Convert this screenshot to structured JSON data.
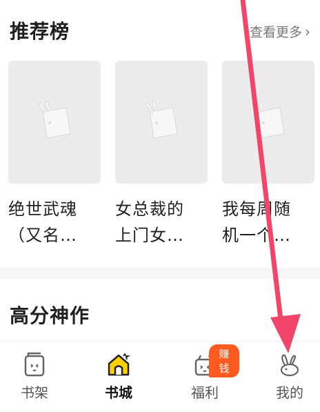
{
  "recommend": {
    "title": "推荐榜",
    "see_more": "查看更多",
    "books": [
      {
        "line1": "绝世武魂",
        "line2": "（又名…"
      },
      {
        "line1": "女总裁的",
        "line2": "上门女…"
      },
      {
        "line1": "我每周随",
        "line2": "机一个…"
      }
    ]
  },
  "section2": {
    "title": "高分神作"
  },
  "tabbar": {
    "tabs": [
      {
        "label": "书架"
      },
      {
        "label": "书城"
      },
      {
        "label": "福利"
      },
      {
        "label": "我的"
      }
    ],
    "welfare_badge": "赚钱",
    "active_tab": "书城"
  },
  "icons": {
    "cover_placeholder": "rabbit-book-icon",
    "shelf": "book-shelf-icon",
    "store": "house-icon",
    "welfare": "gift-box-icon",
    "mine": "rabbit-icon",
    "see_more": "chevron-right-icon"
  },
  "colors": {
    "accent": "#ffd000",
    "badge": "#ff5a1f",
    "annotation_arrow": "#f2456a"
  }
}
